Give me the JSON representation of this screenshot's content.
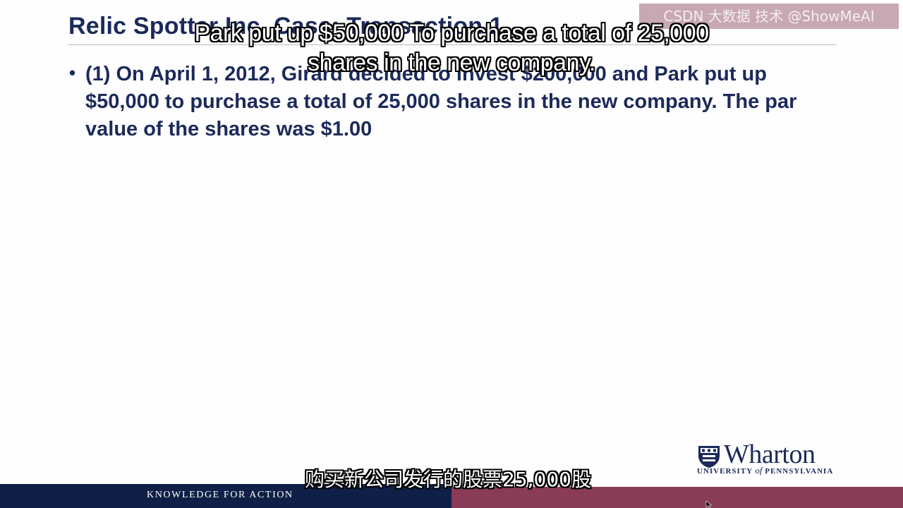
{
  "slide": {
    "title": "Relic Spotter Inc. Case: Transaction 1",
    "bullets": [
      {
        "marker": "•",
        "text": "(1) On April 1, 2012, Girard decided to invest $200,000 and Park put up $50,000 to purchase a total of 25,000 shares in the new company. The par value of the shares was $1.00"
      }
    ]
  },
  "watermark": {
    "text": "CSDN 大数据 技术 @ShowMeAI"
  },
  "subtitles": {
    "english": "Park put up $50,000 To purchase a total of 25,000 shares in the new company.",
    "chinese": "购买新公司发行的股票25,000股"
  },
  "branding": {
    "logo_word": "Wharton",
    "logo_sub_1": "UNIVERSITY",
    "logo_sub_of": "of",
    "logo_sub_2": "PENNSYLVANIA",
    "footer_tagline": "KNOWLEDGE FOR ACTION"
  },
  "colors": {
    "navy": "#1c2a5a",
    "footer_navy": "#0f1f47",
    "footer_burgundy": "#8a3b57"
  }
}
